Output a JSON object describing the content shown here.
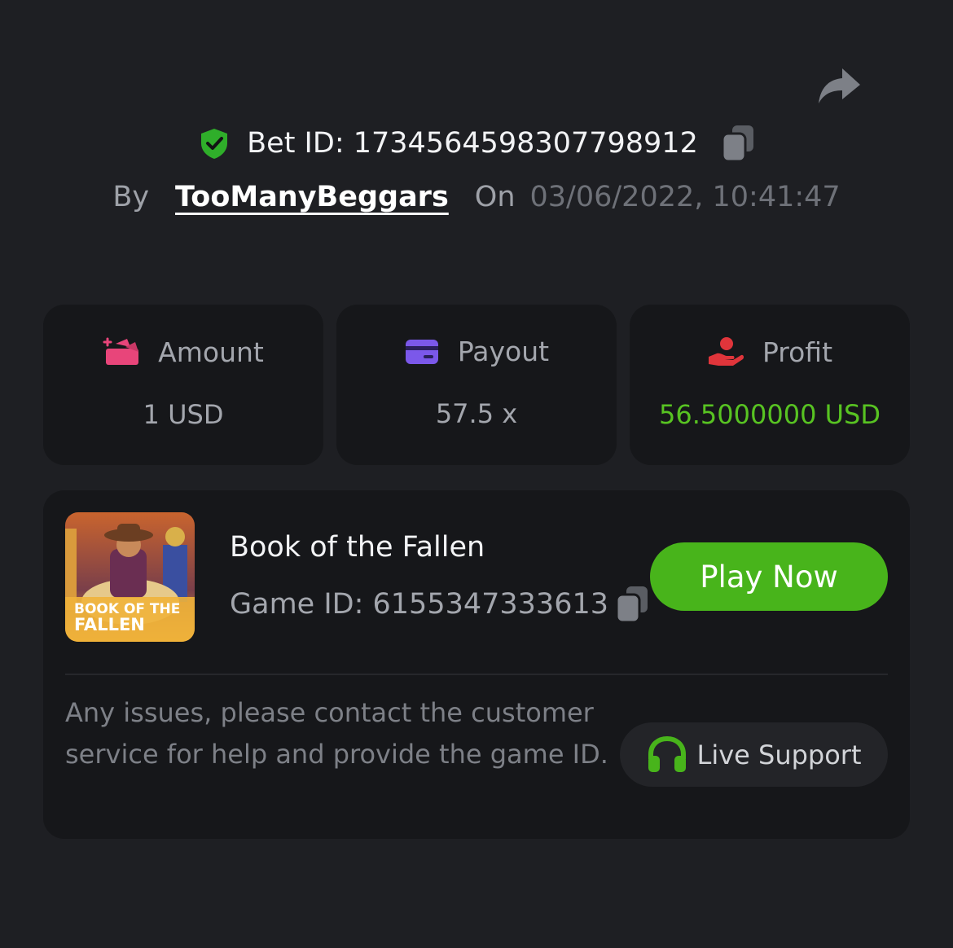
{
  "header": {
    "bet_id_label": "Bet ID: 1734564598307798912",
    "by_label": "By",
    "username": "TooManyBeggars",
    "on_label": "On",
    "datetime": "03/06/2022, 10:41:47",
    "icons": [
      "share-icon",
      "shield-check-icon",
      "copy-icon"
    ]
  },
  "stats": [
    {
      "label": "Amount",
      "value": "1 USD",
      "icon": "wallet-sparkle-icon",
      "icon_color": "#e8457a"
    },
    {
      "label": "Payout",
      "value": "57.5 x",
      "icon": "card-icon",
      "icon_color": "#7b58ea"
    },
    {
      "label": "Profit",
      "value": "56.5000000 USD",
      "icon": "hand-coin-icon",
      "icon_color": "#e0353b",
      "value_color": "#58c322"
    }
  ],
  "game": {
    "title": "Book of the Fallen",
    "game_id_label": "Game ID: 6155347333613",
    "play_label": "Play Now",
    "thumb_title_line1": "BOOK OF THE",
    "thumb_title_line2": "FALLEN",
    "note": "Any issues, please contact the customer service for help and provide the game ID.",
    "support_label": "Live Support"
  },
  "colors": {
    "background": "#1e1f23",
    "card": "#16171a",
    "accent_green": "#48b41b",
    "profit_green": "#58c322"
  }
}
